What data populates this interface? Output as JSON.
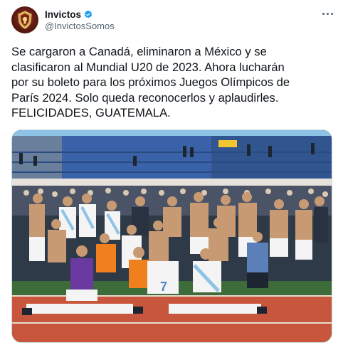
{
  "author": {
    "display_name": "Invictos",
    "handle": "@InvictosSomos",
    "verified": true,
    "avatar_icon": "team-crest-icon"
  },
  "menu": {
    "icon": "more-options-icon"
  },
  "tweet": {
    "text": "Se cargaron a Canadá, eliminaron a México y se\nclasificaron al Mundial U20 de 2023. Ahora lucharán\npor su boleto para los próximos Juegos Olímpicos de\nParís 2024. Solo queda reconocerlos y aplaudirles.\nFELICIDADES, GUATEMALA."
  },
  "media": {
    "kind": "photo",
    "subject": "team-celebration-photo",
    "jersey_number": "7",
    "colors": {
      "sky_blue": "#8ec3e6",
      "purple_jersey": "#6a3aa0",
      "orange_jersey": "#f07f1e",
      "track_red": "#c8563c",
      "stands_blue": "#3a62a8"
    }
  },
  "colors": {
    "verified_blue": "#1d9bf0",
    "text": "#0f1419",
    "muted": "#536471"
  }
}
